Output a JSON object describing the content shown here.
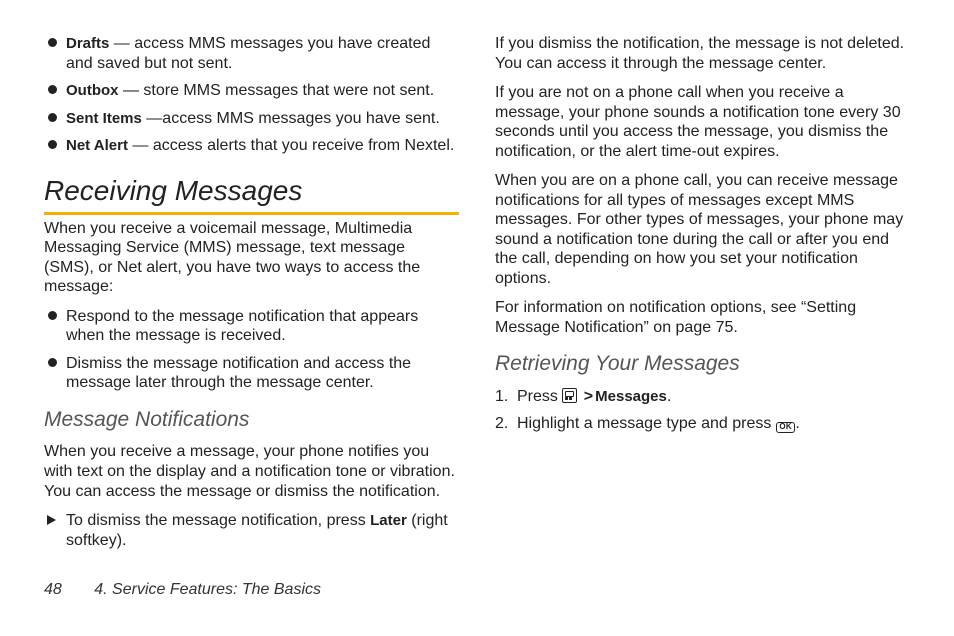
{
  "folders": {
    "drafts": {
      "label": "Drafts",
      "desc": " — access MMS messages you have created and saved but not sent."
    },
    "outbox": {
      "label": "Outbox",
      "desc": " — store MMS messages that were not sent."
    },
    "sent": {
      "label": "Sent Items",
      "desc": " —access MMS messages you have sent."
    },
    "netalert": {
      "label": "Net Alert",
      "desc": " — access alerts that you receive from Nextel."
    }
  },
  "receiving": {
    "heading": "Receiving Messages",
    "intro": "When you receive a voicemail message, Multimedia Messaging Service (MMS) message, text message (SMS), or Net alert, you have two ways to access the message:",
    "opts": [
      "Respond to the message notification that appears when the message is received.",
      "Dismiss the message notification and access the message later through the message center."
    ]
  },
  "notif": {
    "heading": "Message Notifications",
    "p1": "When you receive a message, your phone notifies you with text on the display and a notification tone or vibration. You can access the message or dismiss the notification.",
    "dismiss_pre": "To dismiss the message notification, press ",
    "dismiss_key": "Later",
    "dismiss_post": " (right softkey).",
    "p3": "If you dismiss the notification, the message is not deleted. You can access it through the message center.",
    "p4": "If you are not on a phone call when you receive a message, your phone sounds a notification tone every 30 seconds until you access the message, you dismiss the notification, or the alert time-out expires.",
    "p5": "When you are on a phone call, you can receive message notifications for all types of messages except MMS messages. For other types of messages, your phone may sound a notification tone during the call or after you end the call, depending on how you set your notification options.",
    "p6": "For information on notification options, see “Setting Message Notification” on page 75."
  },
  "retrieve": {
    "heading": "Retrieving Your Messages",
    "step1_pre": "Press ",
    "step1_gt": ">",
    "step1_msg": "Messages",
    "step1_post": ".",
    "step2_pre": "Highlight a message type and press ",
    "step2_ok": "OK",
    "step2_post": "."
  },
  "footer": {
    "page": "48",
    "title": "4. Service Features: The Basics"
  }
}
